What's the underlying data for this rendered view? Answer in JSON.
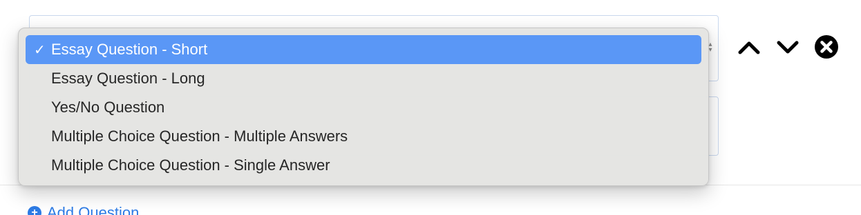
{
  "question_form": {
    "question_type_select": {
      "selected_index": 0,
      "options": [
        "Essay Question - Short",
        "Essay Question - Long",
        "Yes/No Question",
        "Multiple Choice Question - Multiple Answers",
        "Multiple Choice Question - Single Answer"
      ]
    },
    "actions": {
      "move_up_icon": "chevron-up-icon",
      "move_down_icon": "chevron-down-icon",
      "delete_icon": "close-circle-icon"
    },
    "add_question_label": "Add Question"
  },
  "colors": {
    "selected_option_bg": "#5a97f6",
    "link_blue": "#2d7be5",
    "field_border": "#c9d8ee"
  },
  "check_glyph": "✓"
}
